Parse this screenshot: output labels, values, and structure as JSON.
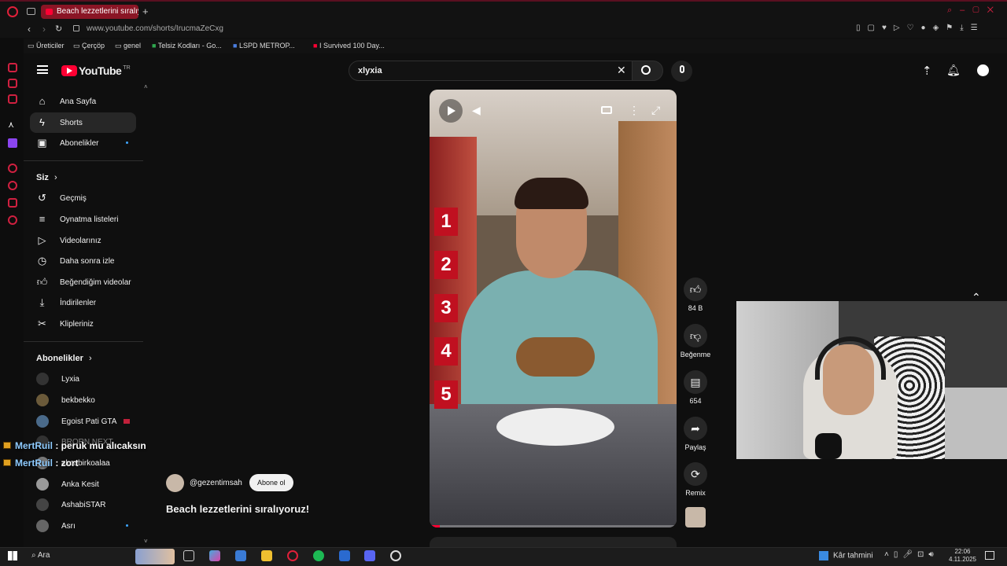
{
  "browser": {
    "tab_title": "Beach lezzetlerini sıralıyor",
    "url": "www.youtube.com/shorts/IrucmaZeCxg",
    "bookmarks": [
      "Üreticiler",
      "Çerçöp",
      "genel",
      "Telsiz Kodları - Go...",
      "LSPD METROP...",
      "I Survived 100 Day..."
    ]
  },
  "header": {
    "logo": "YouTube",
    "region": "TR",
    "search_value": "xlyxia"
  },
  "sidebar": {
    "main": [
      {
        "label": "Ana Sayfa",
        "icon": "home-icon"
      },
      {
        "label": "Shorts",
        "icon": "shorts-icon"
      },
      {
        "label": "Abonelikler",
        "icon": "subscriptions-icon"
      }
    ],
    "siz_title": "Siz",
    "siz": [
      {
        "label": "Geçmiş",
        "icon": "history-icon"
      },
      {
        "label": "Oynatma listeleri",
        "icon": "playlist-icon"
      },
      {
        "label": "Videolarınız",
        "icon": "videos-icon"
      },
      {
        "label": "Daha sonra izle",
        "icon": "watch-later-icon"
      },
      {
        "label": "Beğendiğim videolar",
        "icon": "like-icon"
      },
      {
        "label": "İndirilenler",
        "icon": "download-icon"
      },
      {
        "label": "Klipleriniz",
        "icon": "scissors-icon"
      }
    ],
    "subs_title": "Abonelikler",
    "subs": [
      {
        "label": "Lyxia",
        "color": "#333"
      },
      {
        "label": "bekbekko",
        "color": "#6b5a3a"
      },
      {
        "label": "Egoist Pati GTA",
        "color": "#4a6a8a"
      },
      {
        "label": "BRORN NEXT",
        "color": "#555"
      },
      {
        "label": "akcabirkoalaa",
        "color": "#777"
      },
      {
        "label": "Anka Kesit",
        "color": "#999"
      },
      {
        "label": "AshabiSTAR",
        "color": "#444"
      },
      {
        "label": "Asrı",
        "color": "#666"
      }
    ]
  },
  "short": {
    "channel": "@gezentimsah",
    "subscribe": "Abone ol",
    "title": "Beach lezzetlerini sıralıyoruz!",
    "rank_numbers": [
      "1",
      "2",
      "3",
      "4",
      "5"
    ]
  },
  "actions": {
    "likes": "84 B",
    "dislike": "Beğenme",
    "comments": "654",
    "share": "Paylaş",
    "remix": "Remix"
  },
  "chat": [
    {
      "user": "MertRuil",
      "text": "peruk mu alıcaksın"
    },
    {
      "user": "MertRuil",
      "text": "zort"
    }
  ],
  "taskbar": {
    "search": "Ara",
    "weather": "Kâr tahmini",
    "time": "22:06",
    "date": "4.11.2025"
  }
}
